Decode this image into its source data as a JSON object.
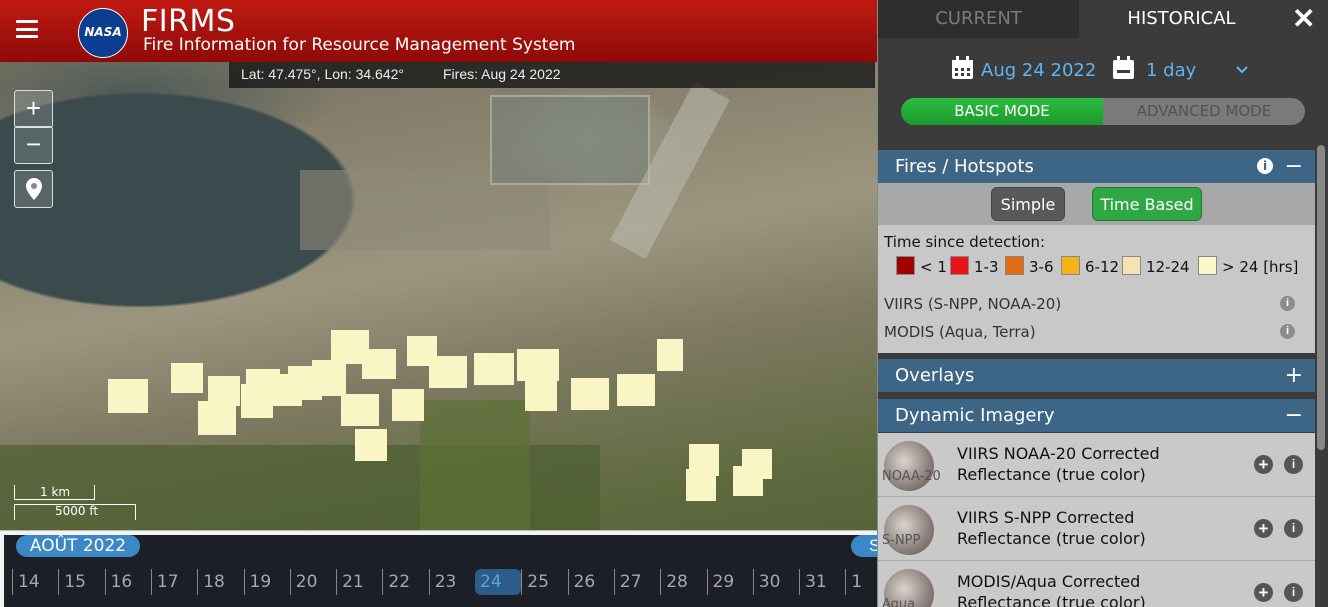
{
  "header": {
    "logo_text": "NASA",
    "title": "FIRMS",
    "subtitle": "Fire Information for Resource Management System"
  },
  "coord_bar": {
    "lat_lon": "Lat: 47.475°, Lon: 34.642°",
    "fires_date": "Fires: Aug 24 2022"
  },
  "map_controls": {
    "zoom_in": "+",
    "zoom_out": "−"
  },
  "scale": {
    "km": "1 km",
    "ft": "5000 ft"
  },
  "timeline": {
    "month": "AOÛT 2022",
    "next_month": "S",
    "days": [
      "14",
      "15",
      "16",
      "17",
      "18",
      "19",
      "20",
      "21",
      "22",
      "23",
      "24",
      "25",
      "26",
      "27",
      "28",
      "29",
      "30",
      "31",
      "1"
    ],
    "selected_day": "24"
  },
  "panel": {
    "tab_current": "CURRENT",
    "tab_historical": "HISTORICAL",
    "close": "✕",
    "date": "Aug 24 2022",
    "duration": "1 day",
    "mode_basic": "BASIC MODE",
    "mode_advanced": "ADVANCED MODE",
    "fires_section": {
      "title": "Fires / Hotspots",
      "toggle": "−",
      "btn_simple": "Simple",
      "btn_time": "Time Based",
      "detect_label": "Time since detection:",
      "legend": [
        {
          "label": "< 1",
          "color": "#a00000"
        },
        {
          "label": "1-3",
          "color": "#e8141a"
        },
        {
          "label": "3-6",
          "color": "#e26a10"
        },
        {
          "label": "6-12",
          "color": "#f2b418"
        },
        {
          "label": "12-24",
          "color": "#f7e2b0"
        },
        {
          "label": "> 24 [hrs]",
          "color": "#f9f7cb"
        }
      ],
      "sensors": [
        "VIIRS (S-NPP, NOAA-20)",
        "MODIS (Aqua, Terra)"
      ]
    },
    "overlays_section": {
      "title": "Overlays",
      "toggle": "+"
    },
    "dynamic_section": {
      "title": "Dynamic Imagery",
      "toggle": "−"
    },
    "imagery": [
      {
        "thumb": "NOAA-20",
        "line1": "VIIRS NOAA-20 Corrected",
        "line2": "Reflectance (true color)"
      },
      {
        "thumb": "S-NPP",
        "line1": "VIIRS S-NPP Corrected",
        "line2": "Reflectance (true color)"
      },
      {
        "thumb": "Aqua",
        "line1": "MODIS/Aqua Corrected",
        "line2": "Reflectance (true color)"
      }
    ]
  },
  "colors": {
    "header_red": "#b3140f",
    "section_blue": "#3d6585",
    "accent_blue": "#5fb4f2",
    "active_green": "#2fa844",
    "fire_pixel": "#f9f5c4"
  }
}
